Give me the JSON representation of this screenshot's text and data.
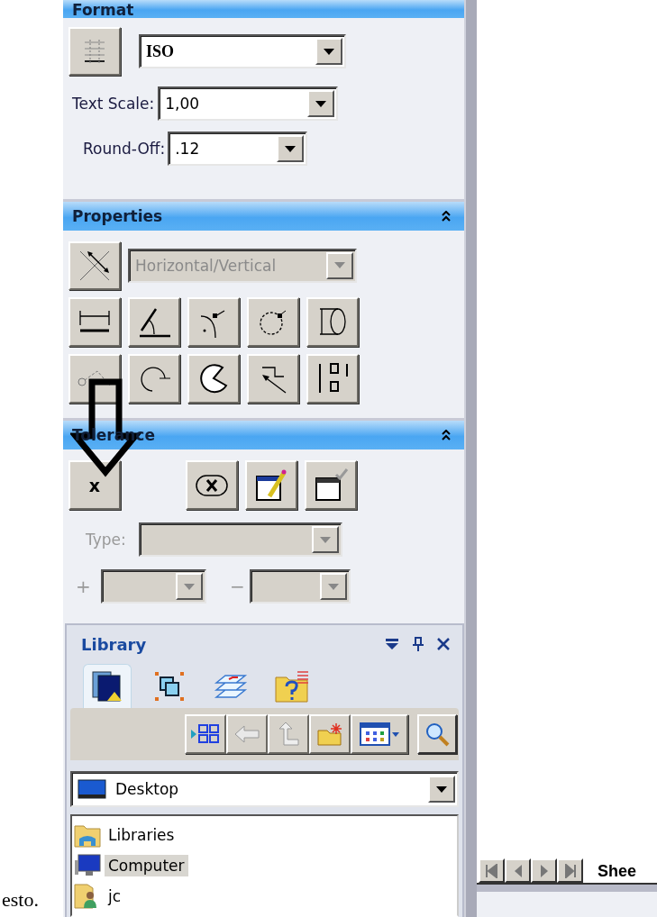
{
  "format": {
    "title": "Format",
    "style": {
      "value": "ISO"
    },
    "text_scale": {
      "label": "Text Scale:",
      "value": "1,00"
    },
    "round_off": {
      "label": "Round-Off:",
      "value": ".12"
    }
  },
  "properties": {
    "title": "Properties",
    "orientation": {
      "value": "Horizontal/Vertical",
      "disabled": true
    }
  },
  "tolerance": {
    "title": "Tolerance",
    "x_button": "x",
    "type": {
      "label": "Type:",
      "disabled": true
    },
    "plus": {
      "label": "+",
      "disabled": true
    },
    "minus": {
      "label": "−",
      "disabled": true
    }
  },
  "library": {
    "title": "Library",
    "tabs": [
      {
        "selected": true
      },
      {
        "selected": false
      },
      {
        "selected": false
      },
      {
        "selected": false
      }
    ],
    "location": "Desktop",
    "items": [
      {
        "label": "Libraries",
        "selected": false
      },
      {
        "label": "Computer",
        "selected": true
      },
      {
        "label": "jc",
        "selected": false
      }
    ]
  },
  "sheet_tab": "Shee",
  "caption": "esto."
}
